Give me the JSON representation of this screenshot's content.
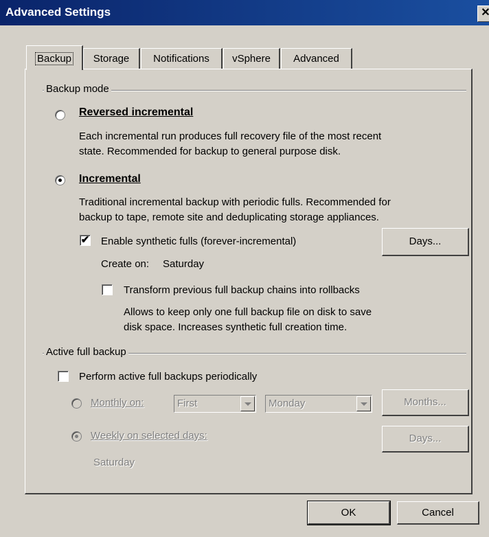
{
  "window": {
    "title": "Advanced Settings",
    "close_glyph": "✕"
  },
  "tabs": [
    {
      "label": "Backup",
      "active": true
    },
    {
      "label": "Storage",
      "active": false
    },
    {
      "label": "Notifications",
      "active": false
    },
    {
      "label": "vSphere",
      "active": false
    },
    {
      "label": "Advanced",
      "active": false
    }
  ],
  "backup_mode": {
    "group_label": "Backup mode",
    "reversed": {
      "label": "Reversed incremental",
      "desc_line1": "Each incremental run produces full recovery file of the most recent",
      "desc_line2": "state. Recommended for backup to general purpose disk.",
      "selected": false
    },
    "incremental": {
      "label": "Incremental",
      "desc_line1": "Traditional incremental backup with periodic fulls. Recommended for",
      "desc_line2": "backup to tape, remote site and deduplicating storage appliances.",
      "selected": true
    },
    "synthetic": {
      "label": "Enable synthetic fulls (forever-incremental)",
      "checked": true,
      "days_button": "Days...",
      "create_on_label": "Create on:",
      "create_on_value": "Saturday"
    },
    "transform": {
      "label": "Transform previous full backup chains into rollbacks",
      "checked": false,
      "desc_line1": "Allows to keep only one full backup file on disk to save",
      "desc_line2": "disk space. Increases synthetic full creation time."
    }
  },
  "active_full": {
    "group_label": "Active full backup",
    "perform": {
      "label": "Perform active full backups periodically",
      "checked": false
    },
    "monthly": {
      "label": "Monthly on:",
      "selected": false,
      "week_value": "First",
      "day_value": "Monday",
      "months_button": "Months..."
    },
    "weekly": {
      "label": "Weekly on selected days:",
      "selected": true,
      "days_button": "Days...",
      "summary": "Saturday"
    }
  },
  "footer": {
    "ok": "OK",
    "cancel": "Cancel"
  },
  "colors": {
    "titlebar": "#0a246a",
    "face": "#d4d0c8",
    "disabled_text": "#808080"
  }
}
